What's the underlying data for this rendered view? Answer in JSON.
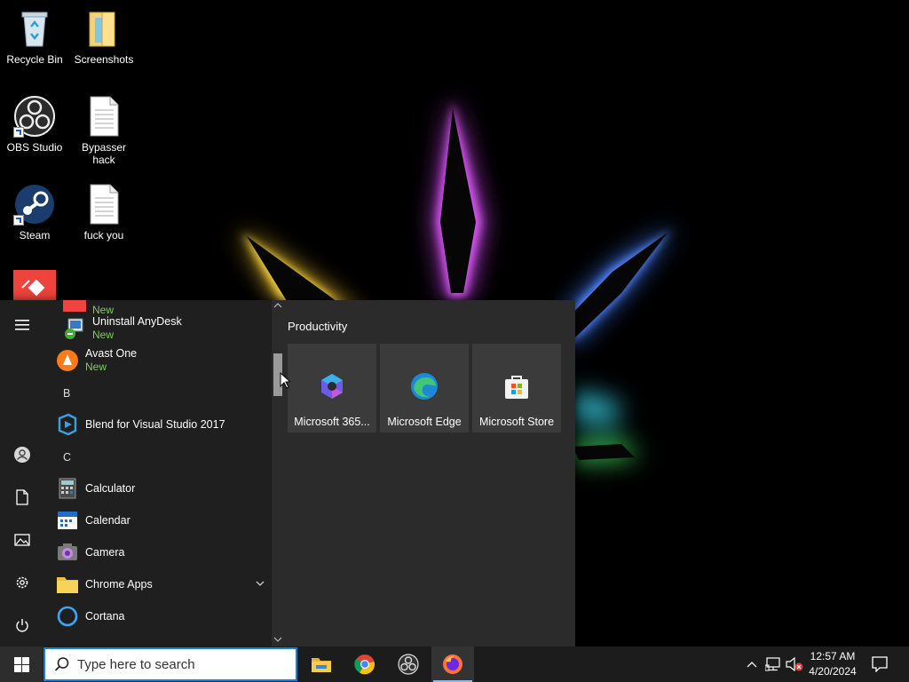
{
  "desktop": {
    "icons": [
      {
        "label": "Recycle Bin",
        "icon": "recycle-bin-icon"
      },
      {
        "label": "Screenshots",
        "icon": "folder-icon"
      },
      {
        "label": "OBS Studio",
        "icon": "obs-icon"
      },
      {
        "label": "Bypasser hack",
        "icon": "text-file-icon"
      },
      {
        "label": "Steam",
        "icon": "steam-icon"
      },
      {
        "label": "fuck you",
        "icon": "text-file-icon"
      }
    ]
  },
  "start_menu": {
    "app_list": {
      "partial_top_new": "New",
      "items": [
        {
          "name": "Uninstall AnyDesk",
          "badge": "New",
          "icon": "anydesk-uninstall-icon"
        },
        {
          "name": "Avast One",
          "badge": "New",
          "icon": "avast-icon"
        },
        {
          "name": "Blend for Visual Studio 2017",
          "icon": "blend-icon"
        },
        {
          "name": "Calculator",
          "icon": "calculator-icon"
        },
        {
          "name": "Calendar",
          "icon": "calendar-icon"
        },
        {
          "name": "Camera",
          "icon": "camera-icon"
        },
        {
          "name": "Chrome Apps",
          "icon": "folder-icon"
        },
        {
          "name": "Cortana",
          "icon": "cortana-icon"
        }
      ],
      "letters": [
        "B",
        "C"
      ]
    },
    "tiles": {
      "group_title": "Productivity",
      "items": [
        {
          "label": "Microsoft 365...",
          "icon": "microsoft-365-icon"
        },
        {
          "label": "Microsoft Edge",
          "icon": "edge-icon"
        },
        {
          "label": "Microsoft Store",
          "icon": "store-icon"
        }
      ]
    }
  },
  "taskbar": {
    "search_placeholder": "Type here to search",
    "pinned": [
      "file-explorer-icon",
      "chrome-icon",
      "obs-icon",
      "firefox-icon"
    ],
    "clock": {
      "time": "12:57 AM",
      "date": "4/20/2024"
    }
  },
  "colors": {
    "accent": "#1d7fd4",
    "new_badge": "#7fcf5c"
  }
}
